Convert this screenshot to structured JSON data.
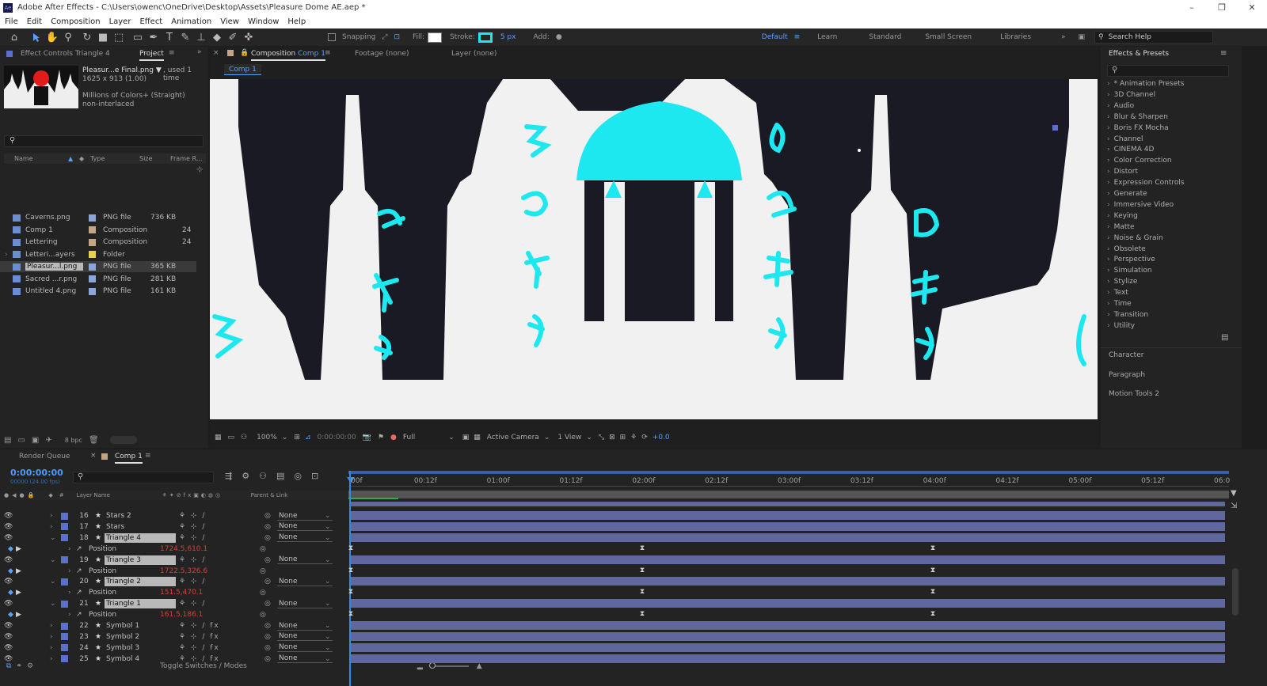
{
  "window": {
    "title": "Adobe After Effects - C:\\Users\\owenc\\OneDrive\\Desktop\\Assets\\Pleasure Dome AE.aep *",
    "app_icon": "Ae"
  },
  "menu": [
    "File",
    "Edit",
    "Composition",
    "Layer",
    "Effect",
    "Animation",
    "View",
    "Window",
    "Help"
  ],
  "toolbar": {
    "snapping": "Snapping",
    "fill": "Fill:",
    "stroke": "Stroke:",
    "stroke_width": "5 px",
    "add": "Add:",
    "workspaces": [
      "Default",
      "Learn",
      "Standard",
      "Small Screen",
      "Libraries"
    ],
    "search_help": "Search Help"
  },
  "project": {
    "tab_effect_controls": "Effect Controls Triangle 4",
    "tab_project": "Project",
    "preview_name": "Pleasur...e Final.png ▼",
    "preview_used": ", used 1 time",
    "preview_dims": "1625 x 913 (1.00)",
    "preview_colors": "Millions of Colors+ (Straight)",
    "preview_interlace": "non-interlaced",
    "columns": [
      "Name",
      "Type",
      "Size",
      "Frame R..."
    ],
    "items": [
      {
        "name": "Caverns.png",
        "type": "PNG file",
        "size": "736 KB",
        "fr": "",
        "color": "#8aa6d6",
        "icon": "png-file-icon"
      },
      {
        "name": "Comp 1",
        "type": "Composition",
        "size": "",
        "fr": "24",
        "color": "#c5a483",
        "icon": "composition-icon"
      },
      {
        "name": "Lettering",
        "type": "Composition",
        "size": "",
        "fr": "24",
        "color": "#c5a483",
        "icon": "composition-icon"
      },
      {
        "name": "Letteri...ayers",
        "type": "Folder",
        "size": "",
        "fr": "",
        "color": "#e6d24a",
        "icon": "folder-icon"
      },
      {
        "name": "Pleasur...l.png",
        "type": "PNG file",
        "size": "365 KB",
        "fr": "",
        "color": "#8aa6d6",
        "icon": "png-file-icon",
        "selected": true
      },
      {
        "name": "Sacred ...r.png",
        "type": "PNG file",
        "size": "281 KB",
        "fr": "",
        "color": "#8aa6d6",
        "icon": "png-file-icon"
      },
      {
        "name": "Untitled 4.png",
        "type": "PNG file",
        "size": "161 KB",
        "fr": "",
        "color": "#8aa6d6",
        "icon": "png-file-icon"
      }
    ],
    "bpc": "8 bpc"
  },
  "composition": {
    "tab": "Composition",
    "tab_name": "Comp 1",
    "footage": "Footage (none)",
    "layer": "Layer (none)",
    "breadcrumb": "Comp 1",
    "zoom": "100%",
    "timecode": "0:00:00:00",
    "resolution": "Full",
    "camera": "Active Camera",
    "view": "1 View",
    "exposure": "+0.0"
  },
  "effects": {
    "title": "Effects & Presets",
    "items": [
      "* Animation Presets",
      "3D Channel",
      "Audio",
      "Blur & Sharpen",
      "Boris FX Mocha",
      "Channel",
      "CINEMA 4D",
      "Color Correction",
      "Distort",
      "Expression Controls",
      "Generate",
      "Immersive Video",
      "Keying",
      "Matte",
      "Noise & Grain",
      "Obsolete",
      "Perspective",
      "Simulation",
      "Stylize",
      "Text",
      "Time",
      "Transition",
      "Utility"
    ],
    "panels": [
      "Character",
      "Paragraph",
      "Motion Tools 2"
    ]
  },
  "timeline": {
    "tab_render": "Render Queue",
    "tab_comp": "Comp 1",
    "timecode": "0:00:00:00",
    "fps": "00000 (24.00 fps)",
    "columns": {
      "layer_name": "Layer Name",
      "parent": "Parent & Link"
    },
    "ruler": [
      "00f",
      "00:12f",
      "01:00f",
      "01:12f",
      "02:00f",
      "02:12f",
      "03:00f",
      "03:12f",
      "04:00f",
      "04:12f",
      "05:00f",
      "05:12f",
      "06:0"
    ],
    "rows": [
      {
        "num": "16",
        "name": "Stars 2",
        "parent": "None",
        "kind": "layer"
      },
      {
        "num": "17",
        "name": "Stars",
        "parent": "None",
        "kind": "layer"
      },
      {
        "num": "18",
        "name": "Triangle 4",
        "parent": "None",
        "kind": "layer",
        "sel": true
      },
      {
        "num": "",
        "name": "Position",
        "value": "1724.5,610.1",
        "kind": "prop"
      },
      {
        "num": "19",
        "name": "Triangle 3",
        "parent": "None",
        "kind": "layer",
        "sel": true
      },
      {
        "num": "",
        "name": "Position",
        "value": "1722.5,326.6",
        "kind": "prop"
      },
      {
        "num": "20",
        "name": "Triangle 2",
        "parent": "None",
        "kind": "layer",
        "sel": true
      },
      {
        "num": "",
        "name": "Position",
        "value": "151.5,470.1",
        "kind": "prop"
      },
      {
        "num": "21",
        "name": "Triangle 1",
        "parent": "None",
        "kind": "layer",
        "sel": true
      },
      {
        "num": "",
        "name": "Position",
        "value": "161.5,186.1",
        "kind": "prop"
      },
      {
        "num": "22",
        "name": "Symbol 1",
        "parent": "None",
        "kind": "layer"
      },
      {
        "num": "23",
        "name": "Symbol 2",
        "parent": "None",
        "kind": "layer"
      },
      {
        "num": "24",
        "name": "Symbol 3",
        "parent": "None",
        "kind": "layer"
      },
      {
        "num": "25",
        "name": "Symbol 4",
        "parent": "None",
        "kind": "layer"
      }
    ],
    "toggle": "Toggle Switches / Modes"
  },
  "colors": {
    "accent": "#2d8ceb",
    "cyan": "#1ee8ef",
    "layer_bar": "#5f679e",
    "label_blue": "#5b6fd1"
  }
}
